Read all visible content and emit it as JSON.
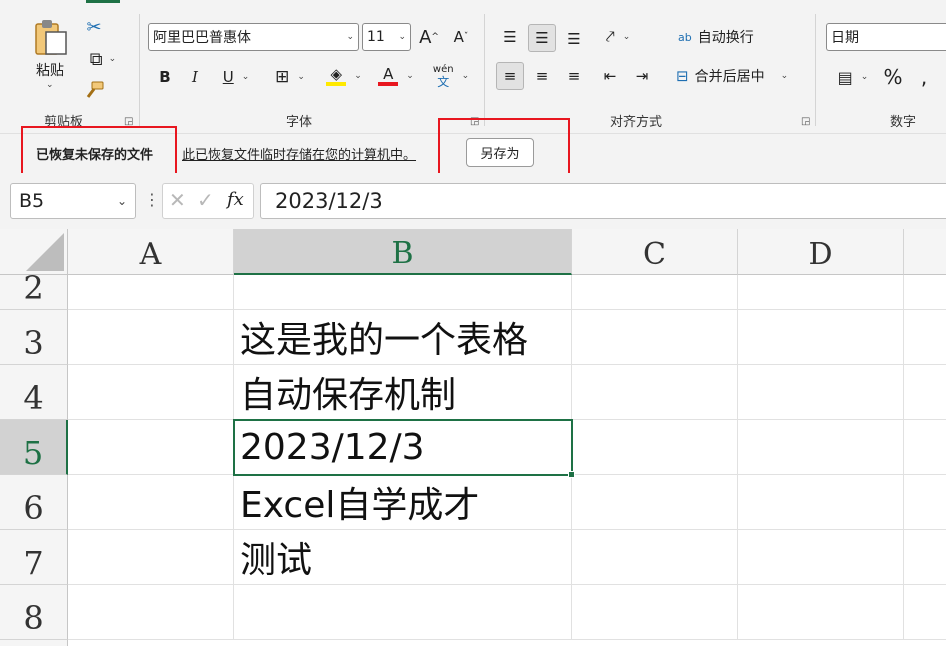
{
  "ribbon": {
    "clipboard": {
      "paste_label": "粘贴",
      "group_label": "剪贴板",
      "icons": [
        "paste-icon",
        "cut-icon",
        "copy-icon",
        "format-painter-icon"
      ]
    },
    "font": {
      "font_name": "阿里巴巴普惠体",
      "font_size": "11",
      "group_label": "字体",
      "grow_label": "A",
      "shrink_label": "A",
      "bold_label": "B",
      "italic_label": "I",
      "underline_label": "U",
      "font_color_label": "A",
      "phonetic_top": "wén",
      "phonetic_bottom": "文",
      "fill_color": "#ffe900",
      "font_color": "#e8161f"
    },
    "alignment": {
      "wrap_label": "自动换行",
      "merge_label": "合并后居中",
      "group_label": "对齐方式",
      "wrap_icon_text": "ab"
    },
    "number": {
      "format": "日期",
      "percent": "%",
      "comma": ",",
      "group_label": "数字"
    }
  },
  "infobar": {
    "title": "已恢复未保存的文件",
    "message": "此已恢复文件临时存储在您的计算机中。",
    "save_as": "另存为"
  },
  "formula_bar": {
    "name_box": "B5",
    "fx": "fx",
    "value": "2023/12/3"
  },
  "sheet": {
    "columns": [
      "A",
      "B",
      "C",
      "D"
    ],
    "rows": [
      "2",
      "3",
      "4",
      "5",
      "6",
      "7",
      "8"
    ],
    "cells": {
      "B3": "这是我的一个表格",
      "B4": "自动保存机制",
      "B5": "2023/12/3",
      "B6": "Excel自学成才",
      "B7": "测试"
    },
    "selected_cell": "B5"
  },
  "annotation_color": "#e8161f",
  "accent_color": "#1e7145"
}
